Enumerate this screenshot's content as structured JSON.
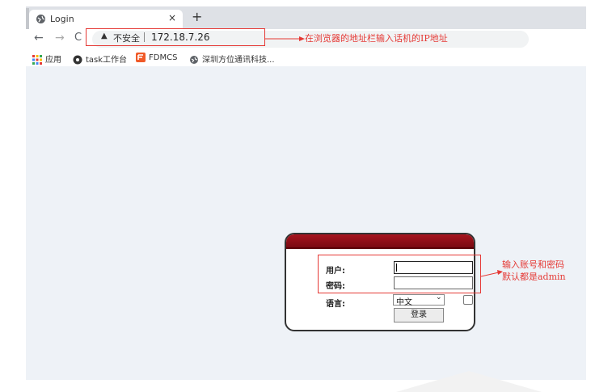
{
  "tab": {
    "title": "Login",
    "close": "×",
    "new_tab": "+"
  },
  "nav": {
    "back": "←",
    "forward": "→",
    "reload": "C"
  },
  "address": {
    "warning_icon": "warning-triangle-icon",
    "insecure": "不安全",
    "url": "172.18.7.26"
  },
  "annotation_address": "在浏览器的地址栏输入话机的IP地址",
  "bookmarks": [
    {
      "label": "应用",
      "icon": "apps-grid-icon"
    },
    {
      "label": "task工作台",
      "icon": "task-icon"
    },
    {
      "label": "FDMCS",
      "icon": "fdmcs-icon"
    },
    {
      "label": "深圳方位通讯科技...",
      "icon": "globe-icon"
    }
  ],
  "login": {
    "user_label": "用户:",
    "password_label": "密码:",
    "language_label": "语言:",
    "language_value": "中文",
    "submit": "登录"
  },
  "annotation_login": {
    "line1": "输入账号和密码",
    "line2": "默认都是admin"
  },
  "colors": {
    "annotation": "#e53935",
    "panel_header": "#8b0d15"
  }
}
